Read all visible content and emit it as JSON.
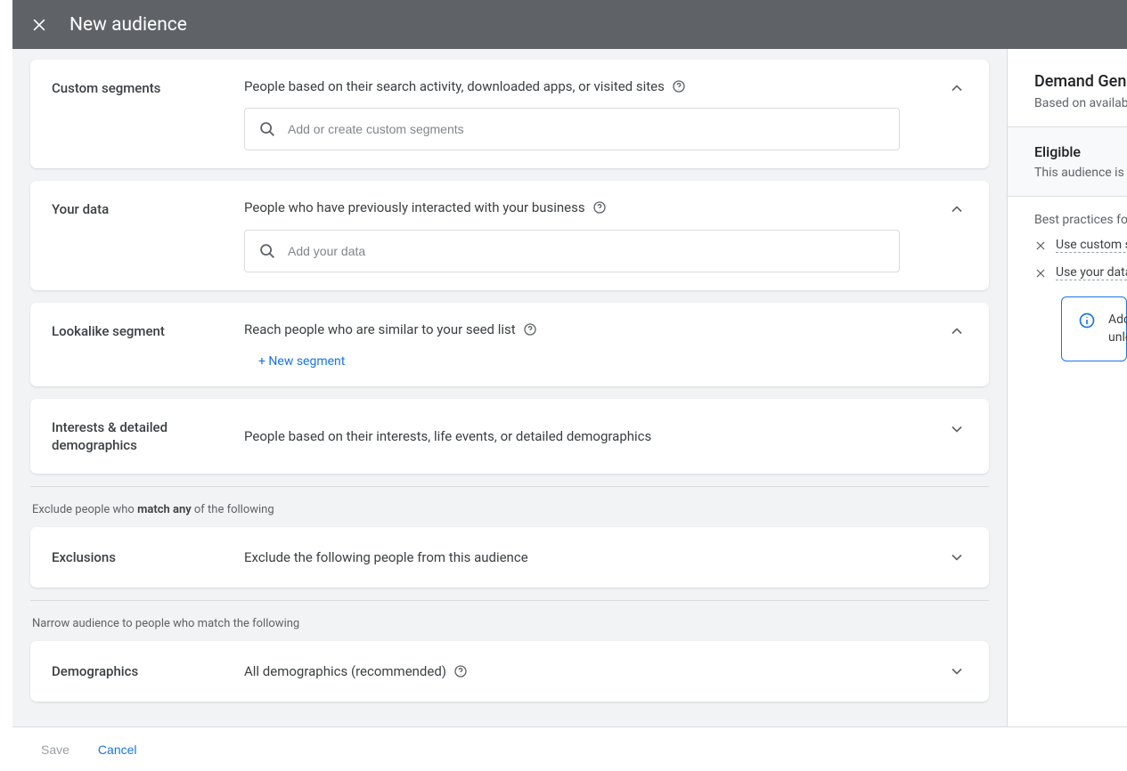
{
  "header": {
    "title": "New audience"
  },
  "sections": {
    "custom": {
      "label": "Custom segments",
      "desc": "People based on their search activity, downloaded apps, or visited sites",
      "placeholder": "Add or create custom segments"
    },
    "yourdata": {
      "label": "Your data",
      "desc": "People who have previously interacted with your business",
      "placeholder": "Add your data"
    },
    "lookalike": {
      "label": "Lookalike segment",
      "desc": "Reach people who are similar to your seed list",
      "new_link": "+ New segment"
    },
    "interests": {
      "label": "Interests & detailed demographics",
      "desc": "People based on their interests, life events, or detailed demographics"
    },
    "exclude_hint_pre": "Exclude people who ",
    "exclude_hint_bold": "match any",
    "exclude_hint_post": " of the following",
    "exclusions": {
      "label": "Exclusions",
      "desc": "Exclude the following people from this audience"
    },
    "narrow_hint": "Narrow audience to people who match the following",
    "demographics": {
      "label": "Demographics",
      "desc": "All demographics (recommended)"
    }
  },
  "side": {
    "top_title": "Demand Gen insights",
    "top_sub": "Based on available",
    "eligible_title": "Eligible",
    "eligible_sub": "This audience is eligible",
    "bp_title": "Best practices for segments",
    "bp_items": [
      "Use custom segments",
      "Use your data"
    ],
    "info_line1": "Add segments",
    "info_line2": "unlock insights"
  },
  "footer": {
    "save": "Save",
    "cancel": "Cancel"
  }
}
